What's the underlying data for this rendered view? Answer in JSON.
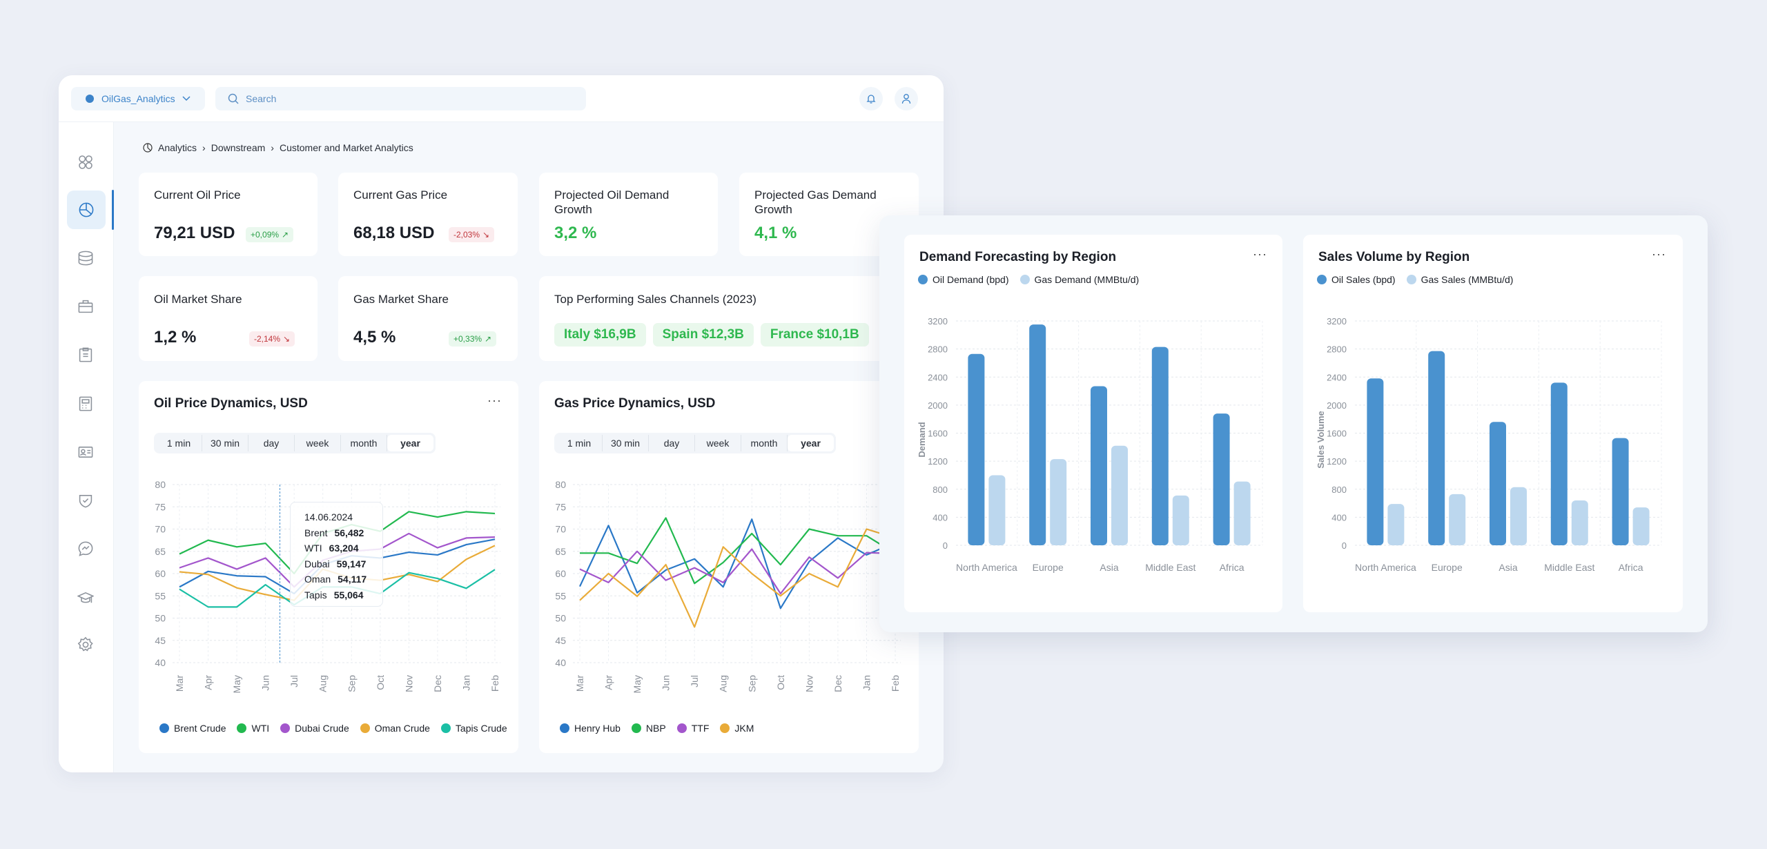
{
  "header": {
    "org": "OilGas_Analytics",
    "search_placeholder": "Search"
  },
  "sidebar": {
    "items": [
      "dashboard-icon",
      "analytics-icon",
      "database-icon",
      "briefcase-icon",
      "clipboard-icon",
      "calculator-icon",
      "id-card-icon",
      "shield-check-icon",
      "messenger-icon",
      "graduation-cap-icon",
      "settings-icon"
    ],
    "active": 1
  },
  "breadcrumb": [
    "Analytics",
    "Downstream",
    "Customer and Market Analytics"
  ],
  "kpis": [
    {
      "title": "Current Oil Price",
      "value": "79,21 USD",
      "change": "+0,09%",
      "trend": "up"
    },
    {
      "title": "Current Gas Price",
      "value": "68,18 USD",
      "change": "-2,03%",
      "trend": "down"
    },
    {
      "title": "Projected Oil Demand Growth",
      "value": "3,2 %"
    },
    {
      "title": "Projected Gas Demand Growth",
      "value": "4,1 %"
    },
    {
      "title": "Oil Market Share",
      "value": "1,2 %",
      "change": "-2,14%",
      "trend": "down"
    },
    {
      "title": "Gas Market Share",
      "value": "4,5 %",
      "change": "+0,33%",
      "trend": "up"
    }
  ],
  "channels": {
    "title": "Top Performing Sales Channels (2023)",
    "items": [
      "Italy $16,9B",
      "Spain $12,3B",
      "France $10,1B"
    ]
  },
  "time_ranges": [
    "1 min",
    "30 min",
    "day",
    "week",
    "month",
    "year"
  ],
  "selected_range": "year",
  "tooltip": {
    "date": "14.06.2024",
    "rows": [
      {
        "label": "Brent",
        "value": "56,482"
      },
      {
        "label": "WTI",
        "value": "63,204"
      },
      {
        "label": "Dubai",
        "value": "59,147"
      },
      {
        "label": "Oman",
        "value": "54,117"
      },
      {
        "label": "Tapis",
        "value": "55,064"
      }
    ]
  },
  "chart_data": [
    {
      "type": "line",
      "title": "Oil Price Dynamics, USD",
      "categories": [
        "Mar",
        "Apr",
        "May",
        "Jun",
        "Jul",
        "Aug",
        "Sep",
        "Oct",
        "Nov",
        "Dec",
        "Jan",
        "Feb"
      ],
      "ylim": [
        40,
        80
      ],
      "yticks": [
        80,
        75,
        70,
        65,
        60,
        55,
        50,
        45,
        40
      ],
      "grid": true,
      "legend": "bottom",
      "series": [
        {
          "name": "Brent Crude",
          "color": "#2a78c7",
          "values": [
            57,
            60.5,
            59.5,
            59.3,
            55.5,
            62,
            64,
            63.5,
            64.8,
            64.2,
            66.5,
            67.7
          ]
        },
        {
          "name": "WTI",
          "color": "#22b94f",
          "values": [
            64.4,
            67.5,
            66,
            66.8,
            60,
            69,
            71,
            69.5,
            73.9,
            72.7,
            73.9,
            73.5
          ]
        },
        {
          "name": "Dubai Crude",
          "color": "#a356cc",
          "values": [
            61.3,
            63.5,
            61,
            63.5,
            57,
            63,
            65,
            65.5,
            69,
            65.8,
            68,
            68.2
          ]
        },
        {
          "name": "Oman Crude",
          "color": "#e9ab38",
          "values": [
            60.4,
            59.8,
            56.8,
            55.3,
            54,
            61,
            59,
            58.5,
            59.8,
            58.2,
            63.2,
            66.3
          ]
        },
        {
          "name": "Tapis Crude",
          "color": "#1bbfa5",
          "values": [
            56.5,
            52.5,
            52.5,
            57.5,
            53,
            57,
            57,
            55.5,
            60.2,
            58.9,
            56.7,
            60.9
          ]
        }
      ]
    },
    {
      "type": "line",
      "title": "Gas Price Dynamics, USD",
      "categories": [
        "Mar",
        "Apr",
        "May",
        "Jun",
        "Jul",
        "Aug",
        "Sep",
        "Oct",
        "Nov",
        "Dec",
        "Jan",
        "Feb"
      ],
      "ylim": [
        40,
        80
      ],
      "yticks": [
        80,
        75,
        70,
        65,
        60,
        55,
        50,
        45,
        40
      ],
      "grid": true,
      "legend": "bottom",
      "series": [
        {
          "name": "Henry Hub",
          "color": "#2a78c7",
          "values": [
            57.1,
            70.8,
            55.7,
            60.8,
            63.3,
            57,
            72.2,
            52.2,
            62.7,
            68,
            64.2,
            67
          ]
        },
        {
          "name": "NBP",
          "color": "#22b94f",
          "values": [
            64.6,
            64.6,
            62.3,
            72.5,
            57.8,
            62.5,
            69,
            62,
            70,
            68.5,
            68.5,
            64.5
          ]
        },
        {
          "name": "TTF",
          "color": "#a356cc",
          "values": [
            61,
            58,
            65,
            58.5,
            61.3,
            58,
            65.5,
            55.5,
            63.7,
            59,
            64.7,
            64.5
          ]
        },
        {
          "name": "JKM",
          "color": "#e9ab38",
          "values": [
            54,
            60,
            54.9,
            62,
            48,
            66,
            60,
            55,
            60,
            57,
            70,
            68
          ]
        }
      ]
    },
    {
      "type": "bar",
      "title": "Demand Forecasting by Region",
      "ylabel": "Demand",
      "categories": [
        "North America",
        "Europe",
        "Asia",
        "Middle East",
        "Africa"
      ],
      "ylim": [
        0,
        3200
      ],
      "yticks": [
        3200,
        2800,
        2400,
        2000,
        1600,
        1200,
        800,
        400,
        0
      ],
      "grid": true,
      "legend": "top-left",
      "series": [
        {
          "name": "Oil Demand (bpd)",
          "color": "#4a92cf",
          "values": [
            2730,
            3150,
            2270,
            2830,
            1880
          ]
        },
        {
          "name": "Gas Demand (MMBtu/d)",
          "color": "#bcd7ee",
          "values": [
            1000,
            1230,
            1420,
            710,
            910
          ]
        }
      ]
    },
    {
      "type": "bar",
      "title": "Sales Volume by Region",
      "ylabel": "Sales Volume",
      "categories": [
        "North America",
        "Europe",
        "Asia",
        "Middle East",
        "Africa"
      ],
      "ylim": [
        0,
        3200
      ],
      "yticks": [
        3200,
        2800,
        2400,
        2000,
        1600,
        1200,
        800,
        400,
        0
      ],
      "grid": true,
      "legend": "top-left",
      "series": [
        {
          "name": "Oil Sales (bpd)",
          "color": "#4a92cf",
          "values": [
            2380,
            2770,
            1760,
            2320,
            1530
          ]
        },
        {
          "name": "Gas Sales (MMBtu/d)",
          "color": "#bcd7ee",
          "values": [
            590,
            730,
            830,
            640,
            540
          ]
        }
      ]
    }
  ]
}
